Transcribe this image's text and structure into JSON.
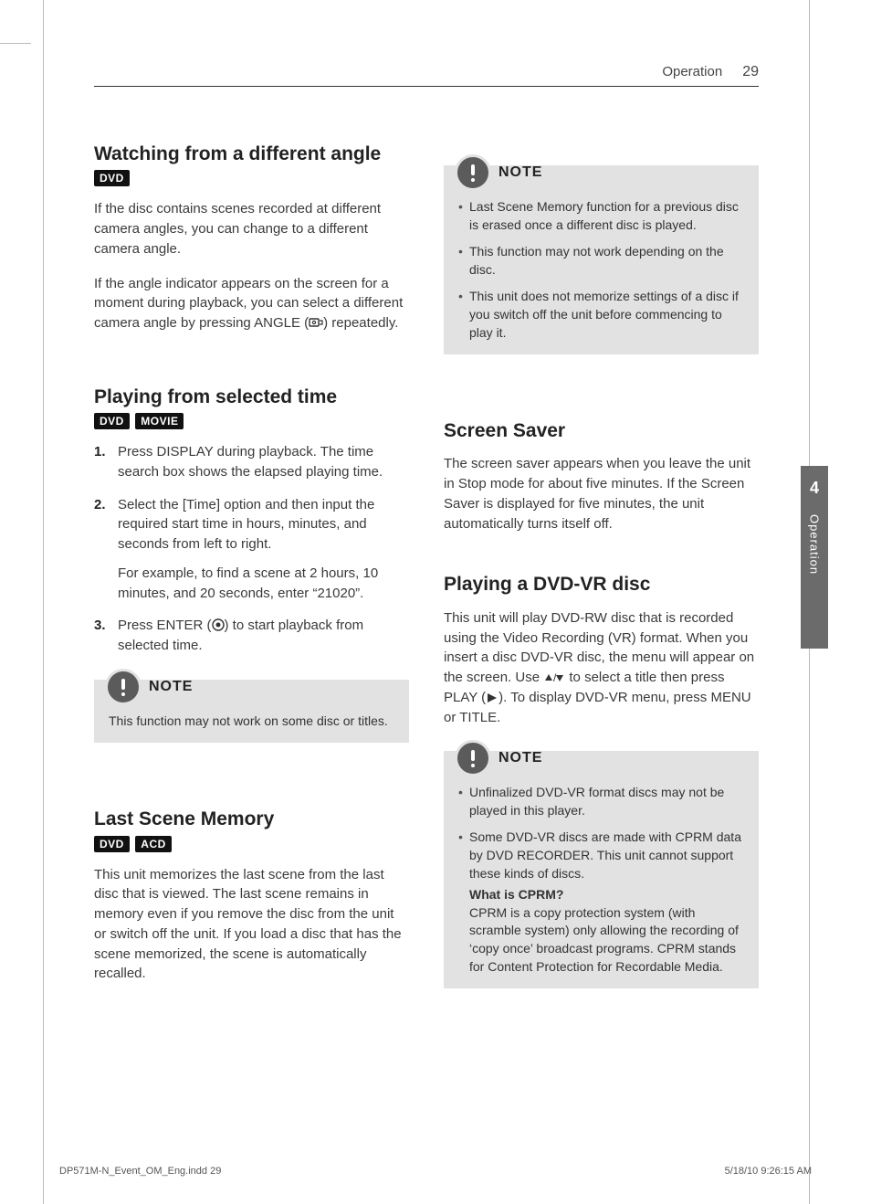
{
  "header": {
    "section": "Operation",
    "page": "29"
  },
  "side_tab": {
    "num": "4",
    "label": "Operation"
  },
  "left": {
    "s1": {
      "title": "Watching from a different angle",
      "pills": [
        "DVD"
      ],
      "p1": "If the disc contains scenes recorded at different camera angles, you can change to a different camera angle.",
      "p2a": "If the angle indicator appears on the screen for a moment during playback, you can select a different camera angle by pressing ANGLE (",
      "p2b": ") repeatedly."
    },
    "s2": {
      "title": "Playing from selected time",
      "pills": [
        "DVD",
        "MOVIE"
      ],
      "step1": "Press DISPLAY during playback. The time search box shows the elapsed playing time.",
      "step2": " Select the [Time] option and then input the required start time in hours, minutes, and seconds from left to right.",
      "step2_sub": "For example, to find a scene at 2 hours, 10 minutes, and 20 seconds, enter “21020”.",
      "step3a": "Press ENTER (",
      "step3b": ") to start playback from selected time.",
      "note": "This function may not work on some disc or titles."
    },
    "s3": {
      "title": "Last Scene Memory",
      "pills": [
        "DVD",
        "ACD"
      ],
      "p1": "This unit memorizes the last scene from the last disc that is viewed. The last scene remains in memory even if you remove the disc from the unit or switch off the unit. If you load a disc that has the scene memorized, the scene is automatically recalled."
    }
  },
  "right": {
    "note1": {
      "items": [
        "Last Scene Memory function for a previous disc is erased once a different disc is played.",
        "This function may not work depending on the disc.",
        "This unit does not memorize settings of a disc if you switch off the unit before commencing to play it."
      ]
    },
    "s1": {
      "title": "Screen Saver",
      "p1": "The screen saver appears when you leave the unit in Stop mode for about five minutes. If the Screen Saver is displayed for five minutes, the unit automatically turns itself off."
    },
    "s2": {
      "title": "Playing a DVD-VR disc",
      "p1a": "This unit will play DVD-RW disc that is recorded using the Video Recording (VR) format. When you insert a disc DVD-VR disc, the menu will appear on the screen. Use ",
      "p1b": " to select a title then press PLAY (",
      "p1c": "). To display DVD-VR menu, press MENU or TITLE."
    },
    "note2": {
      "items": [
        "Unfinalized DVD-VR format discs may not be played in this player.",
        "Some DVD-VR discs are made with CPRM data by DVD RECORDER. This unit cannot support these kinds of discs."
      ],
      "q": "What is CPRM?",
      "qbody": "CPRM is a copy protection system (with scramble system) only allowing the recording of ‘copy once’ broadcast programs. CPRM stands for Content Protection for Recordable Media."
    }
  },
  "note_label": "NOTE",
  "footer": {
    "left": "DP571M-N_Event_OM_Eng.indd   29",
    "right": "5/18/10   9:26:15 AM"
  }
}
